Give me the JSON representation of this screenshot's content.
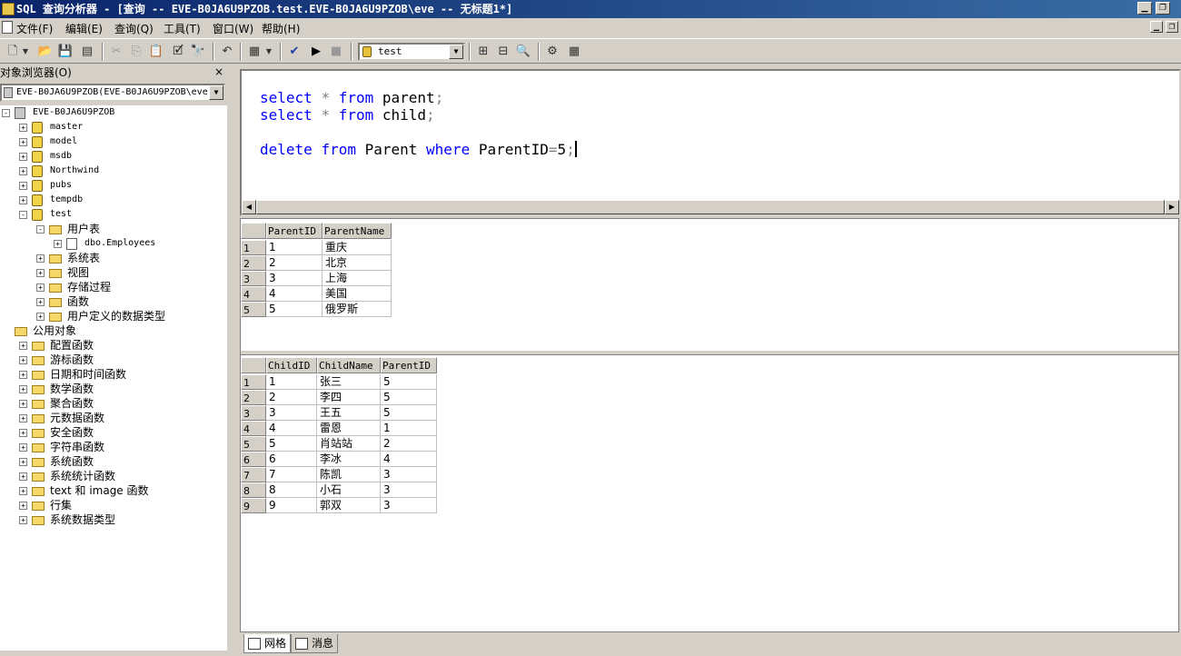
{
  "window": {
    "title": "SQL 查询分析器 - [查询 -- EVE-B0JA6U9PZOB.test.EVE-B0JA6U9PZOB\\eve -- 无标题1*]",
    "controls": [
      "minimize-icon",
      "restore-icon"
    ]
  },
  "menu": {
    "items": [
      "文件(F)",
      "编辑(E)",
      "查询(Q)",
      "工具(T)",
      "窗口(W)",
      "帮助(H)"
    ]
  },
  "toolbar": {
    "database": "test",
    "icons": [
      "new-query-icon",
      "open-icon",
      "save-icon",
      "insert-template-icon",
      "cut-icon",
      "copy-icon",
      "paste-icon",
      "clear-icon",
      "find-icon",
      "undo-icon",
      "results-mode-icon",
      "parse-icon",
      "execute-icon",
      "stop-icon",
      "object-browser-icon",
      "object-search-icon",
      "show-plan-icon",
      "options-icon",
      "grid-icon"
    ]
  },
  "object_browser": {
    "title": "对象浏览器(O)",
    "close": "×",
    "server_combo": "EVE-B0JA6U9PZOB(EVE-B0JA6U9PZOB\\eve)",
    "tree": [
      {
        "label": "EVE-B0JA6U9PZOB",
        "level": 0,
        "icon": "server-icon",
        "expander": "−",
        "mono": true
      },
      {
        "label": "master",
        "level": 1,
        "icon": "database-icon",
        "expander": "+",
        "mono": true
      },
      {
        "label": "model",
        "level": 1,
        "icon": "database-icon",
        "expander": "+",
        "mono": true
      },
      {
        "label": "msdb",
        "level": 1,
        "icon": "database-icon",
        "expander": "+",
        "mono": true
      },
      {
        "label": "Northwind",
        "level": 1,
        "icon": "database-icon",
        "expander": "+",
        "mono": true
      },
      {
        "label": "pubs",
        "level": 1,
        "icon": "database-icon",
        "expander": "+",
        "mono": true
      },
      {
        "label": "tempdb",
        "level": 1,
        "icon": "database-icon",
        "expander": "+",
        "mono": true
      },
      {
        "label": "test",
        "level": 1,
        "icon": "database-icon",
        "expander": "−",
        "mono": true
      },
      {
        "label": "用户表",
        "level": 2,
        "icon": "folder-open-icon",
        "expander": "−",
        "mono": false
      },
      {
        "label": "dbo.Employees",
        "level": 3,
        "icon": "table-icon",
        "expander": "+",
        "mono": true
      },
      {
        "label": "系统表",
        "level": 2,
        "icon": "folder-icon",
        "expander": "+",
        "mono": false
      },
      {
        "label": "视图",
        "level": 2,
        "icon": "folder-icon",
        "expander": "+",
        "mono": false
      },
      {
        "label": "存储过程",
        "level": 2,
        "icon": "folder-icon",
        "expander": "+",
        "mono": false
      },
      {
        "label": "函数",
        "level": 2,
        "icon": "folder-icon",
        "expander": "+",
        "mono": false
      },
      {
        "label": "用户定义的数据类型",
        "level": 2,
        "icon": "folder-icon",
        "expander": "+",
        "mono": false
      },
      {
        "label": "公用对象",
        "level": 0,
        "icon": "folder-icon",
        "expander": "",
        "mono": false
      },
      {
        "label": "配置函数",
        "level": 1,
        "icon": "folder-icon",
        "expander": "+",
        "mono": false
      },
      {
        "label": "游标函数",
        "level": 1,
        "icon": "folder-icon",
        "expander": "+",
        "mono": false
      },
      {
        "label": "日期和时间函数",
        "level": 1,
        "icon": "folder-icon",
        "expander": "+",
        "mono": false
      },
      {
        "label": "数学函数",
        "level": 1,
        "icon": "folder-icon",
        "expander": "+",
        "mono": false
      },
      {
        "label": "聚合函数",
        "level": 1,
        "icon": "folder-icon",
        "expander": "+",
        "mono": false
      },
      {
        "label": "元数据函数",
        "level": 1,
        "icon": "folder-icon",
        "expander": "+",
        "mono": false
      },
      {
        "label": "安全函数",
        "level": 1,
        "icon": "folder-icon",
        "expander": "+",
        "mono": false
      },
      {
        "label": "字符串函数",
        "level": 1,
        "icon": "folder-icon",
        "expander": "+",
        "mono": false
      },
      {
        "label": "系统函数",
        "level": 1,
        "icon": "folder-icon",
        "expander": "+",
        "mono": false
      },
      {
        "label": "系统统计函数",
        "level": 1,
        "icon": "folder-icon",
        "expander": "+",
        "mono": false
      },
      {
        "label": "text 和 image 函数",
        "level": 1,
        "icon": "folder-icon",
        "expander": "+",
        "mono": false
      },
      {
        "label": "行集",
        "level": 1,
        "icon": "folder-icon",
        "expander": "+",
        "mono": false
      },
      {
        "label": "系统数据类型",
        "level": 1,
        "icon": "folder-icon",
        "expander": "+",
        "mono": false
      }
    ]
  },
  "editor": {
    "lines": [
      [
        {
          "t": "select",
          "c": "kw"
        },
        {
          "t": " "
        },
        {
          "t": "*",
          "c": "gr"
        },
        {
          "t": " "
        },
        {
          "t": "from",
          "c": "kw"
        },
        {
          "t": " parent"
        },
        {
          "t": ";",
          "c": "gr"
        }
      ],
      [
        {
          "t": "select",
          "c": "kw"
        },
        {
          "t": " "
        },
        {
          "t": "*",
          "c": "gr"
        },
        {
          "t": " "
        },
        {
          "t": "from",
          "c": "kw"
        },
        {
          "t": " child"
        },
        {
          "t": ";",
          "c": "gr"
        }
      ],
      [],
      [
        {
          "t": "delete",
          "c": "kw"
        },
        {
          "t": " "
        },
        {
          "t": "from",
          "c": "kw"
        },
        {
          "t": " Parent "
        },
        {
          "t": "where",
          "c": "kw"
        },
        {
          "t": " ParentID"
        },
        {
          "t": "=",
          "c": "gr"
        },
        {
          "t": "5"
        },
        {
          "t": ";",
          "c": "gr"
        }
      ]
    ],
    "colors": {
      "keyword": "#0000ff",
      "operator": "#808080"
    }
  },
  "results": {
    "grid1": {
      "columns": [
        "ParentID",
        "ParentName"
      ],
      "rows": [
        [
          "1",
          "重庆"
        ],
        [
          "2",
          "北京"
        ],
        [
          "3",
          "上海"
        ],
        [
          "4",
          "美国"
        ],
        [
          "5",
          "俄罗斯"
        ]
      ]
    },
    "grid2": {
      "columns": [
        "ChildID",
        "ChildName",
        "ParentID"
      ],
      "rows": [
        [
          "1",
          "张三",
          "5"
        ],
        [
          "2",
          "李四",
          "5"
        ],
        [
          "3",
          "王五",
          "5"
        ],
        [
          "4",
          "雷恩",
          "1"
        ],
        [
          "5",
          "肖站站",
          "2"
        ],
        [
          "6",
          "李冰",
          "4"
        ],
        [
          "7",
          "陈凯",
          "3"
        ],
        [
          "8",
          "小石",
          "3"
        ],
        [
          "9",
          "郭双",
          "3"
        ]
      ]
    }
  },
  "tabs": {
    "grid": "网格",
    "messages": "消息"
  }
}
